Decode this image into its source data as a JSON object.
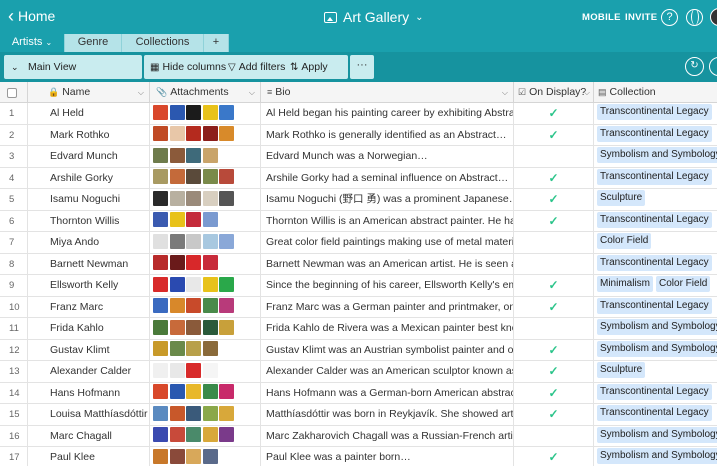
{
  "header": {
    "home_label": "Home",
    "base_title": "Art Gallery",
    "mobile_label": "MOBILE",
    "invite_label": "INVITE",
    "help_glyph": "?"
  },
  "tabs": [
    {
      "label": "Artists",
      "active": true
    },
    {
      "label": "Genre",
      "active": false
    },
    {
      "label": "Collections",
      "active": false
    },
    {
      "label": "+",
      "active": false
    }
  ],
  "toolbar": {
    "view_name": "Main View",
    "hide_columns": "Hide columns",
    "add_filters": "Add filters",
    "apply_sort": "Apply sort",
    "more": "···"
  },
  "columns": {
    "name": "Name",
    "attachments": "Attachments",
    "bio": "Bio",
    "on_display": "On Display?",
    "collection": "Collection"
  },
  "rows": [
    {
      "num": "1",
      "name": "Al Held",
      "bio": "Al Held began his painting career by exhibiting Abstract…",
      "on_display": true,
      "collection": [
        "Transcontinental Legacy"
      ],
      "thumbs": [
        "#d9472b",
        "#2b58b0",
        "#1b1b1b",
        "#e8c21a",
        "#3a78c9"
      ]
    },
    {
      "num": "2",
      "name": "Mark Rothko",
      "bio": "Mark Rothko is generally identified as an Abstract…",
      "on_display": true,
      "collection": [
        "Transcontinental Legacy"
      ],
      "thumbs": [
        "#c04a25",
        "#e8c7a8",
        "#b42a1e",
        "#8c1e1a",
        "#d88a2a"
      ]
    },
    {
      "num": "3",
      "name": "Edvard Munch",
      "bio": "Edvard Munch was a Norwegian…",
      "on_display": false,
      "collection": [
        "Symbolism and Symbology"
      ],
      "thumbs": [
        "#6e7b4b",
        "#8b5a3a",
        "#3e6a7a",
        "#c9a46a"
      ]
    },
    {
      "num": "4",
      "name": "Arshile Gorky",
      "bio": "Arshile Gorky had a seminal influence on Abstract…",
      "on_display": true,
      "collection": [
        "Transcontinental Legacy"
      ],
      "thumbs": [
        "#a89a62",
        "#c46a3a",
        "#5a4a3a",
        "#7a8a4a",
        "#b84a3a"
      ]
    },
    {
      "num": "5",
      "name": "Isamu Noguchi",
      "bio": "Isamu Noguchi (野口 勇) was a prominent Japanese…",
      "on_display": true,
      "collection": [
        "Sculpture"
      ],
      "thumbs": [
        "#2a2a2a",
        "#b8b0a0",
        "#9a8a7a",
        "#d8cfc0",
        "#555555"
      ]
    },
    {
      "num": "6",
      "name": "Thornton Willis",
      "bio": "Thornton Willis is an American abstract painter. He has…",
      "on_display": true,
      "collection": [
        "Transcontinental Legacy"
      ],
      "thumbs": [
        "#3a5ab0",
        "#e8c21a",
        "#c42a3a",
        "#7a9ad0"
      ]
    },
    {
      "num": "7",
      "name": "Miya Ando",
      "bio": "Great color field paintings making use of metal materials…",
      "on_display": false,
      "collection": [
        "Color Field"
      ],
      "thumbs": [
        "#e0e0e0",
        "#7a7a7a",
        "#c8c8c8",
        "#a8c8e0",
        "#8aa8d8"
      ]
    },
    {
      "num": "8",
      "name": "Barnett Newman",
      "bio": "Barnett Newman was an American artist. He is seen as one…",
      "on_display": false,
      "collection": [
        "Transcontinental Legacy"
      ],
      "thumbs": [
        "#b82a2a",
        "#6a1a1a",
        "#d8282a",
        "#c82a3a"
      ]
    },
    {
      "num": "9",
      "name": "Ellsworth Kelly",
      "bio": "Since the beginning of his career, Ellsworth Kelly's emphasi…",
      "on_display": true,
      "collection": [
        "Minimalism",
        "Color Field"
      ],
      "thumbs": [
        "#d82a2a",
        "#2a4ab0",
        "#e8e8e8",
        "#e8c21a",
        "#2aa84a"
      ]
    },
    {
      "num": "10",
      "name": "Franz Marc",
      "bio": "Franz Marc was a German painter and printmaker, one of th…",
      "on_display": true,
      "collection": [
        "Transcontinental Legacy"
      ],
      "thumbs": [
        "#3a6ac0",
        "#d8882a",
        "#c84a2a",
        "#4a8a4a",
        "#b83a7a"
      ]
    },
    {
      "num": "11",
      "name": "Frida Kahlo",
      "bio": "Frida Kahlo de Rivera was a Mexican painter best known for…",
      "on_display": false,
      "collection": [
        "Symbolism and Symbology"
      ],
      "thumbs": [
        "#4a7a3a",
        "#c86a3a",
        "#8a5a3a",
        "#2a5a3a",
        "#c8a03a"
      ]
    },
    {
      "num": "12",
      "name": "Gustav Klimt",
      "bio": "Gustav Klimt was an Austrian symbolist painter and one of t…",
      "on_display": true,
      "collection": [
        "Symbolism and Symbology"
      ],
      "thumbs": [
        "#c89a2a",
        "#6a8a4a",
        "#b8a04a",
        "#8a6a3a"
      ]
    },
    {
      "num": "13",
      "name": "Alexander Calder",
      "bio": "Alexander Calder was an American sculptor known as the…",
      "on_display": true,
      "collection": [
        "Sculpture"
      ],
      "thumbs": [
        "#f0f0f0",
        "#e8e8e8",
        "#d82a2a",
        "#f5f5f5"
      ]
    },
    {
      "num": "14",
      "name": "Hans Hofmann",
      "bio": "Hans Hofmann was a German-born American abstract…",
      "on_display": true,
      "collection": [
        "Transcontinental Legacy"
      ],
      "thumbs": [
        "#d8482a",
        "#2a58b0",
        "#e8b82a",
        "#3a8a4a",
        "#c82a6a"
      ]
    },
    {
      "num": "15",
      "name": "Louisa Matthíasdóttir",
      "bio": "Matthíasdóttir was born in Reykjavík. She showed artistic…",
      "on_display": true,
      "collection": [
        "Transcontinental Legacy"
      ],
      "thumbs": [
        "#5a8ac0",
        "#c8582a",
        "#3a5a7a",
        "#8aa84a",
        "#d8a83a"
      ]
    },
    {
      "num": "16",
      "name": "Marc Chagall",
      "bio": "Marc Zakharovich Chagall was a Russian-French artist…",
      "on_display": false,
      "collection": [
        "Symbolism and Symbology"
      ],
      "thumbs": [
        "#3a4ab0",
        "#c84a3a",
        "#4a8a6a",
        "#d8a83a",
        "#7a3a8a"
      ]
    },
    {
      "num": "17",
      "name": "Paul Klee",
      "bio": "Paul Klee was a painter born…",
      "on_display": true,
      "collection": [
        "Symbolism and Symbology"
      ],
      "thumbs": [
        "#c8782a",
        "#8a4a3a",
        "#d8a85a",
        "#5a6a8a"
      ]
    }
  ],
  "colors": {
    "topbar": "#1aa0ad",
    "toolbar": "#16939f",
    "tag_bg": "#d4e7fb",
    "check": "#2bc48a"
  }
}
